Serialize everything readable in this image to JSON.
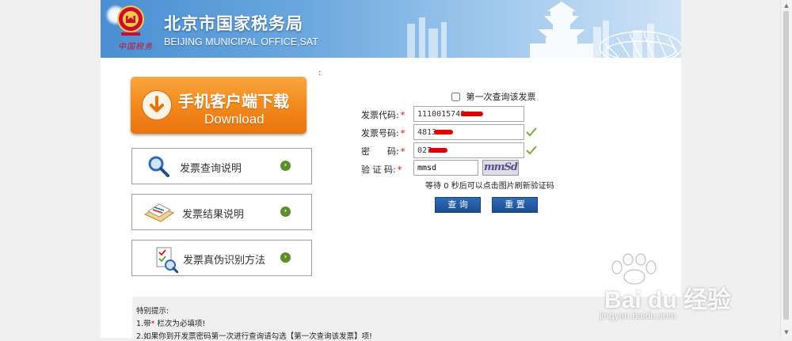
{
  "header": {
    "title_zh": "北京市国家税务局",
    "title_en": "BEIJING MUNICIPAL OFFICE,SAT",
    "slogan": "中国税务"
  },
  "sidebar": {
    "download": {
      "label_zh": "手机客户端下载",
      "label_en": "Download"
    },
    "items": [
      {
        "label": "发票查询说明",
        "icon": "magnifier-icon"
      },
      {
        "label": "发票结果说明",
        "icon": "documents-icon"
      },
      {
        "label": "发票真伪识别方法",
        "icon": "checklist-icon"
      }
    ]
  },
  "stray_colon": ":",
  "form": {
    "first_query_label": "第一次查询该发票",
    "first_query_checked": false,
    "invoice_code": {
      "label": "发票代码:",
      "value": "1110015748"
    },
    "invoice_number": {
      "label": "发票号码:",
      "value": "4813"
    },
    "password": {
      "label": "密　　码:",
      "value": "027"
    },
    "captcha": {
      "label": "验 证 码:",
      "value": "mmsd",
      "image_text": "mmSd"
    },
    "required_mark": "*",
    "captcha_note": "等待 0  秒后可以点击图片刷新验证码",
    "query_button": "查 询",
    "reset_button": "重 置"
  },
  "notice": {
    "title": "特别提示:",
    "line1_prefix": "1.带",
    "line1_mark": "*",
    "line1_suffix": " 栏次为必填项!",
    "line2": "2.如果你到开发票密码第一次进行查询请勾选【第一次查询该发票】项!"
  },
  "watermark": {
    "brand": "Bai du 经验",
    "url": "jingyan.baidu.com"
  },
  "colors": {
    "accent_orange": "#f28a1c",
    "button_blue": "#1c4f93",
    "required_red": "#d40000",
    "check_green": "#7aa93a"
  }
}
